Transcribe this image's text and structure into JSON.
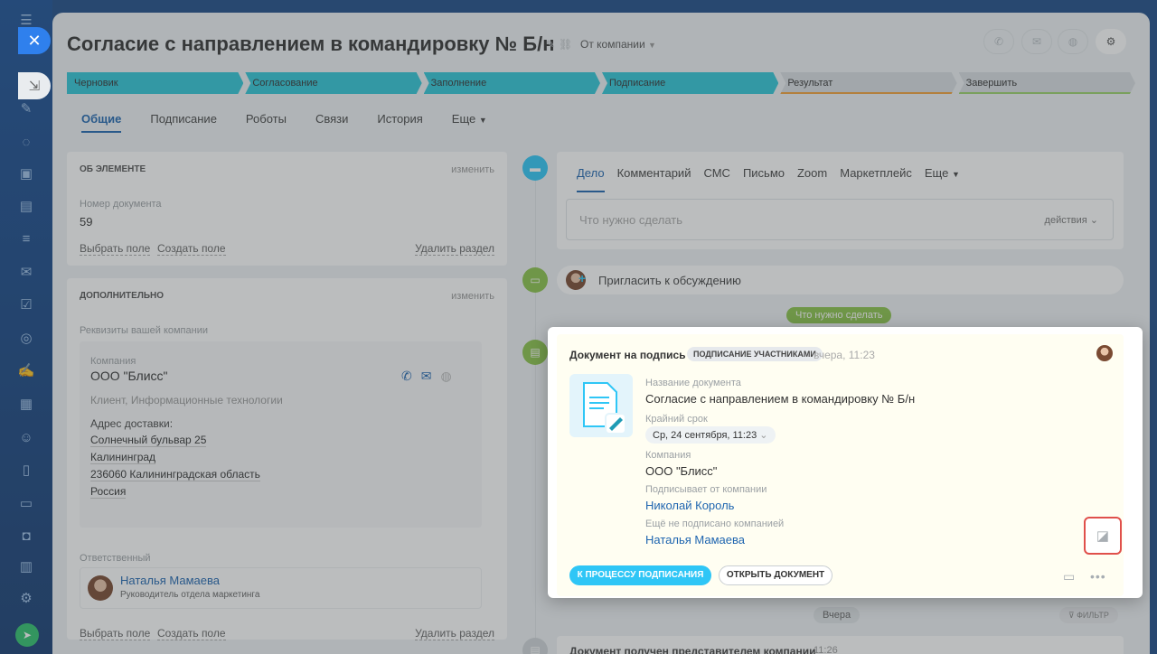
{
  "header": {
    "title": "Согласие с направлением в командировку № Б/н",
    "company_drop": "От компании"
  },
  "stages": [
    "Черновик",
    "Согласование",
    "Заполнение",
    "Подписание",
    "Результат",
    "Завершить"
  ],
  "tabs": [
    "Общие",
    "Подписание",
    "Роботы",
    "Связи",
    "История",
    "Еще"
  ],
  "about": {
    "title": "ОБ ЭЛЕМЕНТЕ",
    "edit": "изменить",
    "field_label": "Номер документа",
    "field_value": "59",
    "choose": "Выбрать поле",
    "create": "Создать поле",
    "delete": "Удалить раздел"
  },
  "extra": {
    "title": "ДОПОЛНИТЕЛЬНО",
    "edit": "изменить",
    "req_label": "Реквизиты вашей компании",
    "company_label": "Компания",
    "company_name": "ООО \"Блисс\"",
    "company_sub": "Клиент, Информационные технологии",
    "addr_label": "Адрес доставки:",
    "addr": [
      "Солнечный бульвар 25",
      "Калининград",
      "236060 Калининградская область",
      "Россия"
    ],
    "resp_label": "Ответственный",
    "resp_name": "Наталья Мамаева",
    "resp_role": "Руководитель отдела маркетинга",
    "choose": "Выбрать поле",
    "create": "Создать поле",
    "delete": "Удалить раздел"
  },
  "activity": {
    "tabs": [
      "Дело",
      "Комментарий",
      "СМС",
      "Письмо",
      "Zoom",
      "Маркетплейс",
      "Еще"
    ],
    "placeholder": "Что нужно сделать",
    "actions": "действия",
    "invite": "Пригласить к обсуждению",
    "todo_pill": "Что нужно сделать",
    "yesterday": "Вчера",
    "filter": "ФИЛЬТР",
    "bottom_item": "Документ получен представителем компании",
    "bottom_time": "11:26"
  },
  "doc": {
    "title": "Документ на подпись",
    "badge": "ПОДПИСАНИЕ УЧАСТНИКАМИ",
    "time": "вчера, 11:23",
    "name_label": "Название документа",
    "name_value": "Согласие с направлением в командировку № Б/н",
    "deadline_label": "Крайний срок",
    "deadline_value": "Ср, 24 сентября, 11:23",
    "company_label": "Компания",
    "company_value": "ООО \"Блисс\"",
    "signer_label": "Подписывает от компании",
    "signer_value": "Николай Король",
    "unsigned_label": "Ещё не подписано компанией",
    "unsigned_value": "Наталья Мамаева",
    "btn_process": "К ПРОЦЕССУ ПОДПИСАНИЯ",
    "btn_open": "ОТКРЫТЬ ДОКУМЕНТ"
  },
  "colors": {
    "stage_done": "#2fc6d8",
    "accent": "#2066b0",
    "highlight": "#e0504b"
  }
}
